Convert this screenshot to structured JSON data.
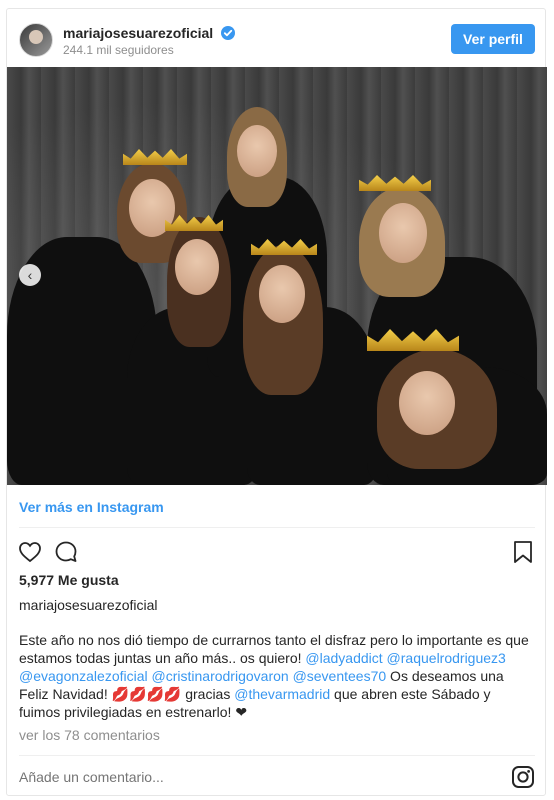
{
  "post": {
    "username": "mariajosesuarezoficial",
    "followers": "244.1 mil seguidores",
    "follow_label": "Ver perfil",
    "view_more": "Ver más en Instagram",
    "likes": "5,977 Me gusta",
    "owner": "mariajosesuarezoficial",
    "caption_parts": {
      "t1": "Este año no nos dió tiempo de currarnos tanto el disfraz pero lo importante es que estamos todas juntas un año más.. os quiero! ",
      "m1": "@ladyaddict",
      "m2": "@raquelrodriguez3",
      "m3": "@evagonzalezoficial",
      "m4": "@cristinarodrigovaron",
      "m5": "@seventees70",
      "t2": " Os deseamos una Feliz Navidad! 💋💋💋💋 gracias ",
      "m6": "@thevarmadrid",
      "t3": " que abren este Sábado y fuimos privilegiadas en estrenarlo! ❤"
    },
    "comments_link": "ver los 78 comentarios",
    "comment_placeholder": "Añade un comentario..."
  },
  "colors": {
    "accent": "#3897f0",
    "text": "#262626",
    "muted": "#8e8e8e"
  },
  "icons": {
    "verified": "verified-badge-icon",
    "like": "heart-icon",
    "comment": "comment-bubble-icon",
    "save": "bookmark-icon",
    "instagram": "instagram-icon",
    "carousel_prev": "chevron-left-icon"
  }
}
